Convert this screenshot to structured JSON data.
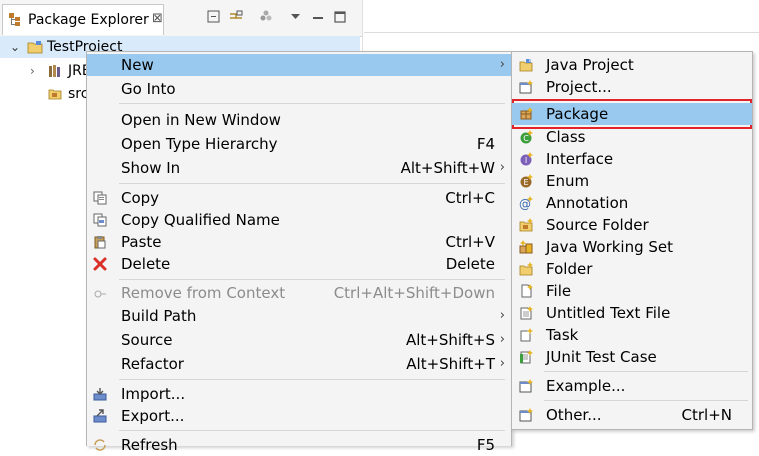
{
  "view": {
    "tab_title": "Package Explorer",
    "tab_close": "⊠"
  },
  "tree": {
    "project": "TestProject",
    "jre_partial": "JRE",
    "src_partial": "src"
  },
  "context_menu": {
    "items": [
      {
        "label": "New",
        "accel": "",
        "submenu": true
      },
      {
        "label": "Go Into",
        "accel": ""
      },
      {
        "label": "Open in New Window",
        "accel": ""
      },
      {
        "label": "Open Type Hierarchy",
        "accel": "F4"
      },
      {
        "label": "Show In",
        "accel": "Alt+Shift+W",
        "submenu": true
      },
      {
        "label": "Copy",
        "accel": "Ctrl+C"
      },
      {
        "label": "Copy Qualified Name",
        "accel": ""
      },
      {
        "label": "Paste",
        "accel": "Ctrl+V"
      },
      {
        "label": "Delete",
        "accel": "Delete"
      },
      {
        "label": "Remove from Context",
        "accel": "Ctrl+Alt+Shift+Down",
        "disabled": true
      },
      {
        "label": "Build Path",
        "accel": "",
        "submenu": true
      },
      {
        "label": "Source",
        "accel": "Alt+Shift+S",
        "submenu": true
      },
      {
        "label": "Refactor",
        "accel": "Alt+Shift+T",
        "submenu": true
      },
      {
        "label": "Import...",
        "accel": ""
      },
      {
        "label": "Export...",
        "accel": ""
      },
      {
        "label": "Refresh",
        "accel": "F5"
      }
    ]
  },
  "new_submenu": {
    "items": [
      {
        "label": "Java Project",
        "icon": "java-project-icon"
      },
      {
        "label": "Project...",
        "icon": "project-icon"
      },
      {
        "label": "Package",
        "icon": "package-icon"
      },
      {
        "label": "Class",
        "icon": "class-icon"
      },
      {
        "label": "Interface",
        "icon": "interface-icon"
      },
      {
        "label": "Enum",
        "icon": "enum-icon"
      },
      {
        "label": "Annotation",
        "icon": "annotation-icon"
      },
      {
        "label": "Source Folder",
        "icon": "source-folder-icon"
      },
      {
        "label": "Java Working Set",
        "icon": "working-set-icon"
      },
      {
        "label": "Folder",
        "icon": "folder-icon"
      },
      {
        "label": "File",
        "icon": "file-icon"
      },
      {
        "label": "Untitled Text File",
        "icon": "text-file-icon"
      },
      {
        "label": "Task",
        "icon": "task-icon"
      },
      {
        "label": "JUnit Test Case",
        "icon": "junit-icon"
      },
      {
        "label": "Example...",
        "icon": "example-icon"
      },
      {
        "label": "Other...",
        "icon": "other-icon",
        "accel": "Ctrl+N"
      }
    ]
  },
  "colors": {
    "highlight": "#99c9ef",
    "selection_outline": "#e0242a",
    "menu_bg": "#f4f4f4"
  },
  "arrow_glyph": "›"
}
